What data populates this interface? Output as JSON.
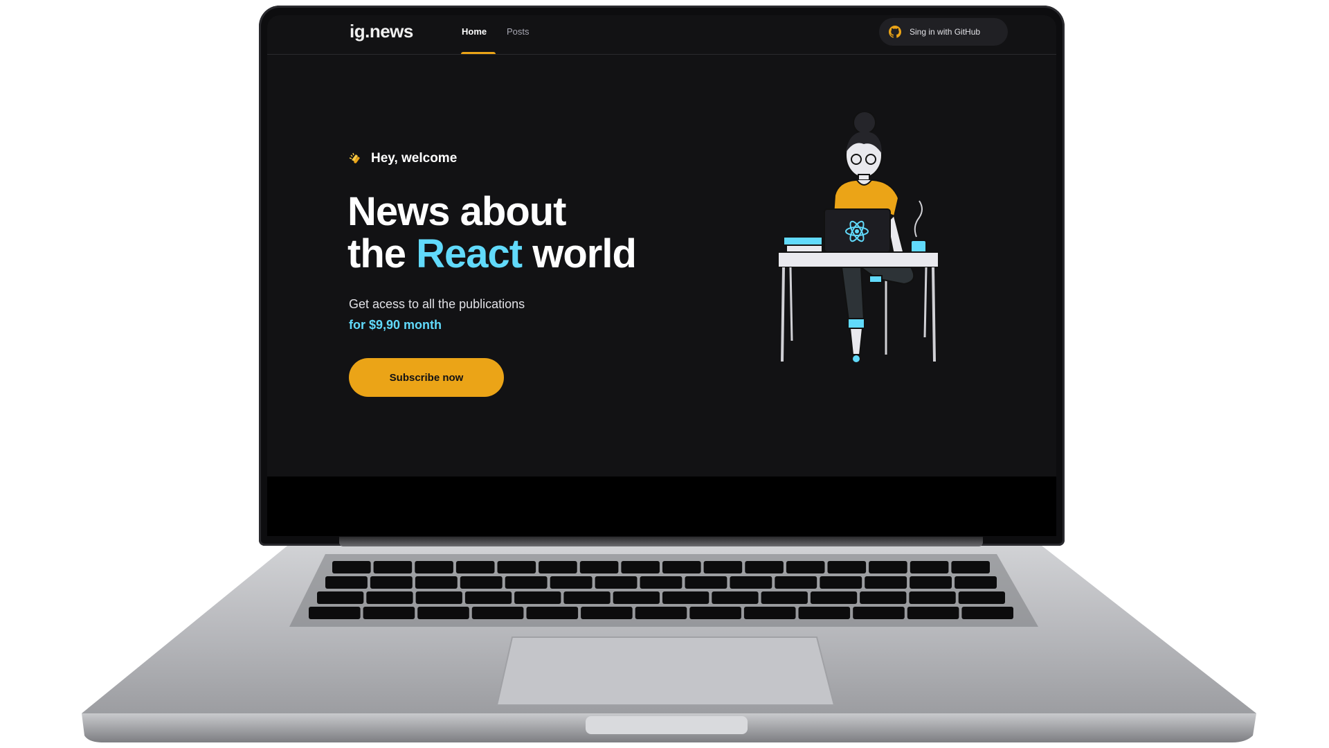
{
  "app": {
    "logo": "ig.news",
    "nav": [
      {
        "label": "Home",
        "active": true
      },
      {
        "label": "Posts",
        "active": false
      }
    ],
    "signin_label": "Sing in with GitHub"
  },
  "hero": {
    "greeting": "Hey, welcome",
    "headline_line1": "News about",
    "headline_line2_prefix": "the",
    "headline_highlight": "React",
    "headline_line2_suffix": "world",
    "subtitle": "Get acess to all the publications",
    "price": "for $9,90 month",
    "cta_label": "Subscribe now"
  },
  "colors": {
    "background": "#121214",
    "accent_yellow": "#eba417",
    "accent_cyan": "#61dafb",
    "text": "#ffffff",
    "laptop_silver": "#b5b6ba"
  },
  "icons": [
    "github-icon",
    "clap-icon",
    "react-logo-icon"
  ]
}
